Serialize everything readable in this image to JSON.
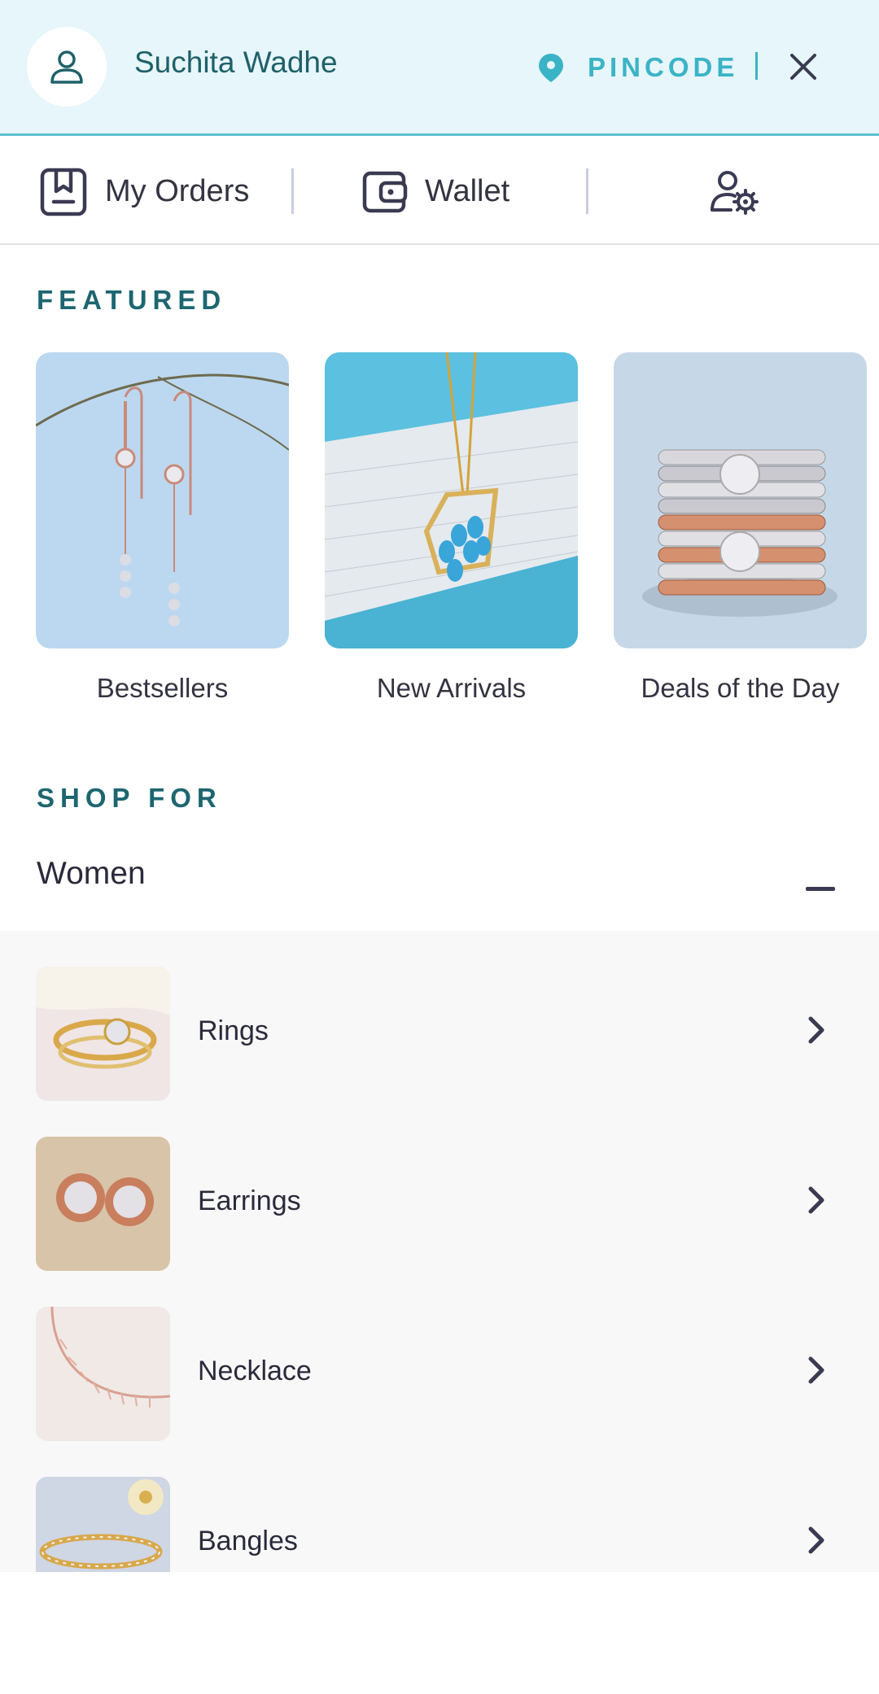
{
  "header": {
    "user_name": "Suchita Wadhe",
    "pincode_label": "PINCODE",
    "icons": {
      "avatar": "user-icon",
      "pin": "location-pin-icon",
      "close": "close-icon"
    }
  },
  "quick_nav": {
    "orders_label": "My Orders",
    "wallet_label": "Wallet",
    "icons": {
      "orders": "bookmark-box-icon",
      "wallet": "wallet-icon",
      "settings": "user-settings-icon"
    }
  },
  "featured": {
    "title": "FEATURED",
    "items": [
      {
        "label": "Bestsellers"
      },
      {
        "label": "New Arrivals"
      },
      {
        "label": "Deals of the Day"
      }
    ]
  },
  "shop_for": {
    "title": "SHOP FOR",
    "group_label": "Women",
    "categories": [
      {
        "label": "Rings"
      },
      {
        "label": "Earrings"
      },
      {
        "label": "Necklace"
      },
      {
        "label": "Bangles"
      }
    ]
  },
  "colors": {
    "header_bg": "#e6f6fa",
    "accent_teal": "#3bb3c6",
    "heading_teal": "#1d6670",
    "panel_bg": "#f8f8f8"
  }
}
